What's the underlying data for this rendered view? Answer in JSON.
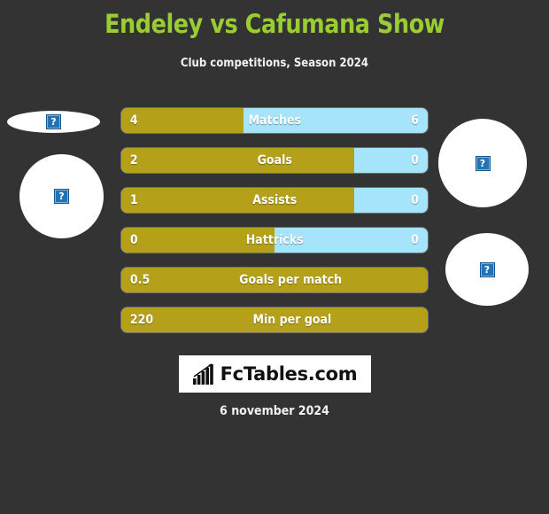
{
  "header": {
    "title": "Endeley vs Cafumana Show",
    "subtitle": "Club competitions, Season 2024",
    "title_color": "#9ACD32"
  },
  "theme": {
    "background": "#333333",
    "home_color": "#B5A019",
    "away_color": "#A5E4FA",
    "text_color": "#FFFFFF"
  },
  "avatars": {
    "left_top": {
      "icon": "broken-image-icon",
      "glyph": "?"
    },
    "left_main": {
      "icon": "broken-image-icon",
      "glyph": "?"
    },
    "right_top": {
      "icon": "broken-image-icon",
      "glyph": "?"
    },
    "right_bottom": {
      "icon": "broken-image-icon",
      "glyph": "?"
    }
  },
  "chart_data": {
    "type": "bar",
    "title": "Endeley vs Cafumana Show",
    "subtitle": "Club competitions, Season 2024",
    "orientation": "horizontal-diverging",
    "legend": [
      "Endeley",
      "Cafumana Show"
    ],
    "categories": [
      "Matches",
      "Goals",
      "Assists",
      "Hattricks",
      "Goals per match",
      "Min per goal"
    ],
    "series": [
      {
        "name": "Endeley",
        "values": [
          "4",
          "2",
          "1",
          "0",
          "0.5",
          "220"
        ],
        "color": "#B5A019"
      },
      {
        "name": "Cafumana Show",
        "values": [
          "6",
          "0",
          "0",
          "0",
          "",
          ""
        ],
        "color": "#A5E4FA"
      }
    ],
    "rows": [
      {
        "label": "Matches",
        "left_value": "4",
        "right_value": "6",
        "left_pct": 40,
        "show_right": true
      },
      {
        "label": "Goals",
        "left_value": "2",
        "right_value": "0",
        "left_pct": 76,
        "show_right": true
      },
      {
        "label": "Assists",
        "left_value": "1",
        "right_value": "0",
        "left_pct": 76,
        "show_right": true
      },
      {
        "label": "Hattricks",
        "left_value": "0",
        "right_value": "0",
        "left_pct": 50,
        "show_right": true
      },
      {
        "label": "Goals per match",
        "left_value": "0.5",
        "right_value": "",
        "left_pct": 100,
        "show_right": false
      },
      {
        "label": "Min per goal",
        "left_value": "220",
        "right_value": "",
        "left_pct": 100,
        "show_right": false
      }
    ]
  },
  "footer": {
    "logo_text": "FcTables.com",
    "logo_icon": "bar-chart-growth-icon",
    "date": "6 november 2024"
  }
}
